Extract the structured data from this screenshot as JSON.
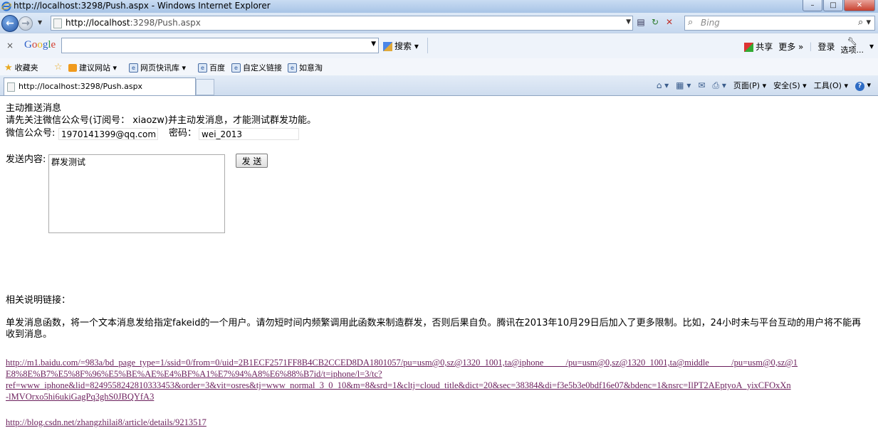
{
  "window": {
    "title": "http://localhost:3298/Push.aspx - Windows Internet Explorer",
    "buttons": {
      "minimize": "–",
      "maximize": "□",
      "close": "✕"
    }
  },
  "address_bar": {
    "url_host": "http://localhost",
    "url_rest": ":3298/Push.aspx",
    "search_placeholder": "Bing"
  },
  "google_toolbar": {
    "close": "×",
    "logo_letters": [
      "G",
      "o",
      "o",
      "g",
      "l",
      "e"
    ],
    "search_label": "搜索",
    "share": "共享",
    "more": "更多 »",
    "login": "登录",
    "options": "选项..."
  },
  "favorites_bar": {
    "favorites": "收藏夹",
    "items": [
      "建议网站 ▾",
      "网页快讯库 ▾",
      "百度",
      "自定义链接",
      "如意淘"
    ]
  },
  "tab_bar": {
    "tab_title": "http://localhost:3298/Push.aspx",
    "commands": {
      "page": "页面(P) ▾",
      "safety": "安全(S) ▾",
      "tools": "工具(O) ▾"
    }
  },
  "page": {
    "heading": "主动推送消息",
    "instruction": "请先关注微信公众号(订阅号： xiaozw)并主动发消息，才能测试群发功能。",
    "account_label": "微信公众号:",
    "account_value": "1970141399@qq.com",
    "password_label": "密码：",
    "password_value": "wei_2013",
    "content_label": "发送内容:",
    "content_value": "群发测试",
    "send_button": "发 送",
    "links_heading": "相关说明链接：",
    "description": "单发消息函数，将一个文本消息发给指定fakeid的一个用户。请勿短时间内频繁调用此函数来制造群发，否则后果自负。腾讯在2013年10月29日后加入了更多限制。比如，24小时未与平台互动的用户将不能再收到消息。",
    "link1_lines": [
      "http://m1.baidu.com/=983a/bd_page_type=1/ssid=0/from=0/uid=2B1ECF2571FF8B4CB2CCED8DA1801057/pu=usm@0,sz@1320_1001,ta@iphone_____/pu=usm@0,sz@1320_1001,ta@middle_____/pu=usm@0,sz@1",
      "E8%8E%B7%E5%8F%96%E5%BE%AE%E4%BF%A1%E7%94%A8%E6%88%B7id/t=iphone/l=3/tc?",
      "ref=www_iphone&lid=8249558242810333453&order=3&vit=osres&tj=www_normal_3_0_10&m=8&srd=1&cltj=cloud_title&dict=20&sec=38384&di=f3e5b3e0bdf16e07&bdenc=1&nsrc=IlPT2AEptyoA_yixCFOxXn",
      "-lMVOrxo5hi6ukiGagPq3ghS0JBQYfA3"
    ],
    "link2": "http://blog.csdn.net/zhangzhilai8/article/details/9213517"
  }
}
